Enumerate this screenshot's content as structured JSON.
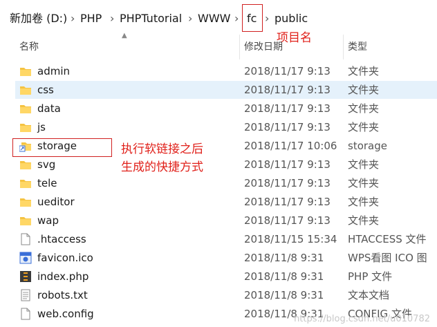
{
  "breadcrumb": {
    "items": [
      "新加卷 (D:)",
      "PHP",
      "PHPTutorial",
      "WWW",
      "fc",
      "public"
    ],
    "separator": "›"
  },
  "annotations": {
    "project_name": "项目名",
    "symlink_line1": "执行软链接之后",
    "symlink_line2": "生成的快捷方式"
  },
  "columns": {
    "name": "名称",
    "date": "修改日期",
    "type": "类型"
  },
  "files": [
    {
      "name": "admin",
      "date": "2018/11/17 9:13",
      "type": "文件夹",
      "icon": "folder-icon"
    },
    {
      "name": "css",
      "date": "2018/11/17 9:13",
      "type": "文件夹",
      "icon": "folder-icon"
    },
    {
      "name": "data",
      "date": "2018/11/17 9:13",
      "type": "文件夹",
      "icon": "folder-icon"
    },
    {
      "name": "js",
      "date": "2018/11/17 9:13",
      "type": "文件夹",
      "icon": "folder-icon"
    },
    {
      "name": "storage",
      "date": "2018/11/17 10:06",
      "type": "storage",
      "icon": "folder-shortcut-icon"
    },
    {
      "name": "svg",
      "date": "2018/11/17 9:13",
      "type": "文件夹",
      "icon": "folder-icon"
    },
    {
      "name": "tele",
      "date": "2018/11/17 9:13",
      "type": "文件夹",
      "icon": "folder-icon"
    },
    {
      "name": "ueditor",
      "date": "2018/11/17 9:13",
      "type": "文件夹",
      "icon": "folder-icon"
    },
    {
      "name": "wap",
      "date": "2018/11/17 9:13",
      "type": "文件夹",
      "icon": "folder-icon"
    },
    {
      "name": ".htaccess",
      "date": "2018/11/15 15:34",
      "type": "HTACCESS 文件",
      "icon": "file-icon"
    },
    {
      "name": "favicon.ico",
      "date": "2018/11/8 9:31",
      "type": "WPS看图 ICO 图",
      "icon": "ico-file-icon"
    },
    {
      "name": "index.php",
      "date": "2018/11/8 9:31",
      "type": "PHP 文件",
      "icon": "php-file-icon"
    },
    {
      "name": "robots.txt",
      "date": "2018/11/8 9:31",
      "type": "文本文档",
      "icon": "text-file-icon"
    },
    {
      "name": "web.config",
      "date": "2018/11/8 9:31",
      "type": "CONFIG 文件",
      "icon": "config-file-icon"
    }
  ],
  "watermark": "https://blog.csdn.net/u010782",
  "colors": {
    "annotation": "#e0201a",
    "folder": "#f5c342",
    "selection": "#e5f1fb"
  }
}
